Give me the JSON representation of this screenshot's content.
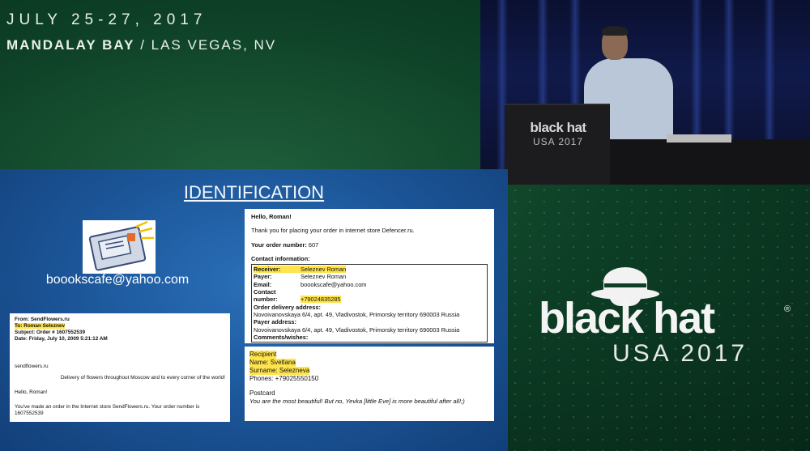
{
  "event": {
    "date": "JULY 25-27, 2017",
    "venue_bold": "MANDALAY BAY",
    "venue_rest": " / LAS VEGAS, NV"
  },
  "stage": {
    "podium_logo": "black hat",
    "podium_sub": "USA 2017"
  },
  "brand": {
    "name": "black hat",
    "registered": "®",
    "sub": "USA 2017"
  },
  "slide": {
    "title": "IDENTIFICATION",
    "email_caption": "boookscafe@yahoo.com",
    "left_doc": {
      "from": "From: SendFlowers.ru",
      "to": "To: Roman Seleznev",
      "subject": "Subject: Order # 1607552539",
      "date": "Date: Friday, July 10, 2009 5:21:12 AM",
      "site": "sendflowers.ru",
      "tagline": "Delivery of flowers throughout Moscow and to every corner of the world!",
      "greeting": "Hello, Roman!",
      "body": "You've made an order in the Internet store SendFlowers.ru. Your order number is 1607552539"
    },
    "right_doc_top": {
      "greeting": "Hello, Roman!",
      "thanks": "Thank you for placing your order in internet store Defencer.ru.",
      "order_label": "Your order number:",
      "order_value": "607",
      "contact_header": "Contact information:",
      "receiver_label": "Receiver:",
      "receiver_value": "Seleznev Roman",
      "payer_label": "Payer:",
      "payer_value": "Seleznev Roman",
      "email_label": "Email:",
      "email_value": "boookscafe@yahoo.com",
      "contact_label": "Contact",
      "number_label": "number:",
      "number_value": "+79024835285",
      "delivery_label": "Order delivery address:",
      "delivery_value": "Novoivanovskaya 6/4, apt. 49, Vladivostok, Primorsky territory 690003 Russia",
      "payer_addr_label": "Payer address:",
      "payer_addr_value": "Novoivanovskaya 6/4, apt. 49, Vladivostok, Primorsky territory 690003 Russia",
      "comments_label": "Comments/wishes:"
    },
    "right_doc_bottom": {
      "recipient": "Recipient",
      "name": "Name: Svetlana",
      "surname": "Surname:  Selezneva",
      "phones": "Phones: +79025550150",
      "postcard": "Postcard",
      "message": "You are the most beautiful! But no, Yevka [little Eve] is more beautiful after all!;)"
    }
  }
}
